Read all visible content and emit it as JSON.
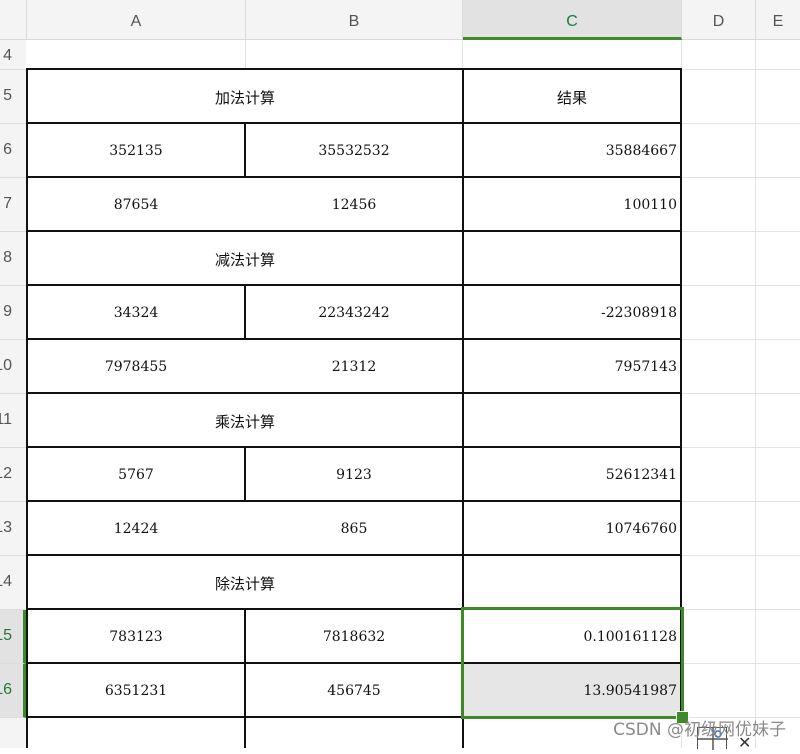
{
  "columns": [
    {
      "id": "A",
      "label": "A"
    },
    {
      "id": "B",
      "label": "B"
    },
    {
      "id": "C",
      "label": "C"
    },
    {
      "id": "D",
      "label": "D"
    },
    {
      "id": "E",
      "label": "E"
    }
  ],
  "rows": [
    "4",
    "5",
    "6",
    "7",
    "8",
    "9",
    "10",
    "11",
    "12",
    "13",
    "14",
    "15",
    "16"
  ],
  "sheet": {
    "r5": {
      "header": "加法计算",
      "result": "结果"
    },
    "r6": {
      "a": "352135",
      "b": "35532532",
      "c": "35884667"
    },
    "r7": {
      "a": "87654",
      "b": "12456",
      "c": "100110"
    },
    "r8": {
      "header": "减法计算"
    },
    "r9": {
      "a": "34324",
      "b": "22343242",
      "c": "-22308918"
    },
    "r10": {
      "a": "7978455",
      "b": "21312",
      "c": "7957143"
    },
    "r11": {
      "header": "乘法计算"
    },
    "r12": {
      "a": "5767",
      "b": "9123",
      "c": "52612341"
    },
    "r13": {
      "a": "12424",
      "b": "865",
      "c": "10746760"
    },
    "r14": {
      "header": "除法计算"
    },
    "r15": {
      "a": "783123",
      "b": "7818632",
      "c": "0.100161128"
    },
    "r16": {
      "a": "6351231",
      "b": "456745",
      "c": "13.90541987"
    }
  },
  "selection": {
    "column": "C",
    "rows": [
      "15",
      "16"
    ],
    "active_cell": "C16"
  },
  "watermark": "CSDN @初级网优妹子",
  "colors": {
    "selection": "#3d8a2a",
    "header_bg": "#f4f4f4",
    "selected_header_bg": "#e2e2e2",
    "active_cell_bg": "#e6e6e6"
  }
}
